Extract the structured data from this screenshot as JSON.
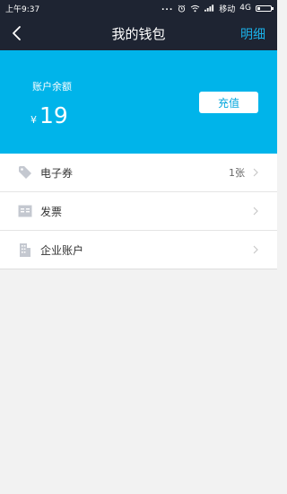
{
  "status_bar": {
    "time": "上午9:37",
    "dots": "...",
    "carrier": "移动",
    "network": "4G"
  },
  "nav": {
    "title": "我的钱包",
    "action_label": "明细"
  },
  "balance": {
    "label": "账户余额",
    "currency": "¥",
    "amount": "19",
    "recharge_label": "充值"
  },
  "menu": [
    {
      "label": "电子券",
      "value": "1张",
      "icon": "tag-icon"
    },
    {
      "label": "发票",
      "value": "",
      "icon": "invoice-icon"
    },
    {
      "label": "企业账户",
      "value": "",
      "icon": "building-icon"
    }
  ],
  "colors": {
    "header_bg": "#1e2432",
    "accent": "#00b4ea",
    "action_text": "#1ab1e8",
    "page_bg": "#f2f2f2"
  }
}
